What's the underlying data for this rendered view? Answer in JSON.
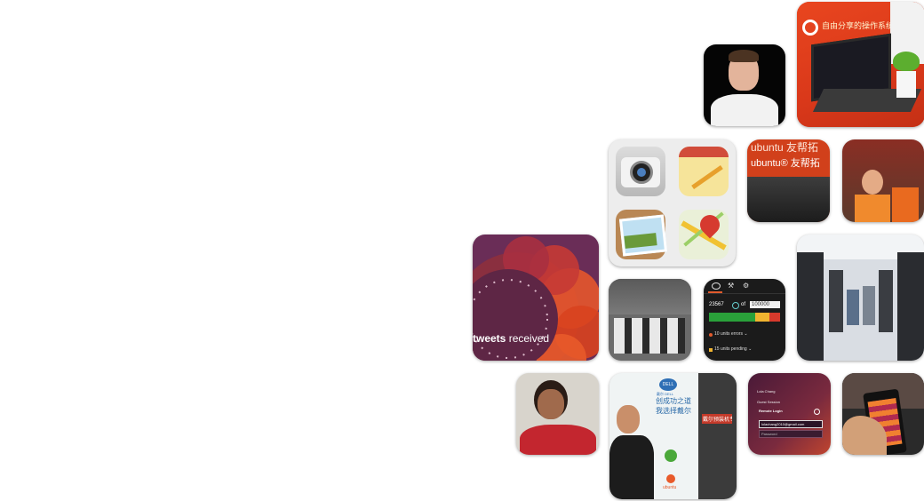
{
  "tiles": {
    "laptop_sign": "自由分享的操作系统",
    "ubuntu_banner_top": "ubuntu 友帮拓",
    "ubuntu_banner_bottom": "ubuntu® 友帮拓",
    "tweets_bold": "tweets",
    "tweets_rest": " received",
    "stats": {
      "tab_icons": [
        "eye-icon",
        "wrench-icon",
        "gear-icon"
      ],
      "value_left": "23567",
      "of_label": "of",
      "value_input": "100000",
      "row1": "10 units errors",
      "row2": "15 units pending"
    },
    "dell_booth": {
      "logo": "DELL",
      "logo_sub": "戴尔 DELL",
      "headline1": "创成功之道",
      "headline2": "我选择戴尔",
      "side_sign": "戴尔预装机专卖",
      "ubuntu_word": "ubuntu"
    },
    "login": {
      "user1": "Lola Chang",
      "user2": "Guest Session",
      "user3": "Remote Login",
      "email": "lolachang2010@gmail.com",
      "password_placeholder": "Password"
    }
  }
}
